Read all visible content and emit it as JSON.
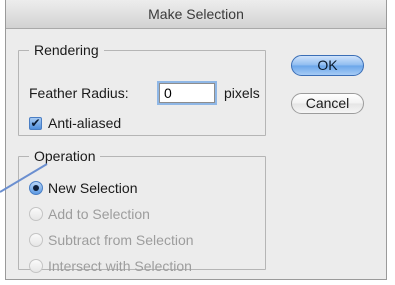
{
  "window": {
    "title": "Make Selection"
  },
  "rendering": {
    "legend": "Rendering",
    "feather_label": "Feather Radius:",
    "feather_value": "0",
    "feather_unit": "pixels",
    "antialiased_label": "Anti-aliased",
    "antialiased_checked": true
  },
  "operation": {
    "legend": "Operation",
    "options": [
      {
        "label": "New Selection",
        "selected": true,
        "enabled": true
      },
      {
        "label": "Add to Selection",
        "selected": false,
        "enabled": false
      },
      {
        "label": "Subtract from Selection",
        "selected": false,
        "enabled": false
      },
      {
        "label": "Intersect with Selection",
        "selected": false,
        "enabled": false
      }
    ]
  },
  "buttons": {
    "ok_label": "OK",
    "cancel_label": "Cancel"
  },
  "colors": {
    "accent": "#5c9ae3",
    "callout_line": "#6b8fd0"
  }
}
